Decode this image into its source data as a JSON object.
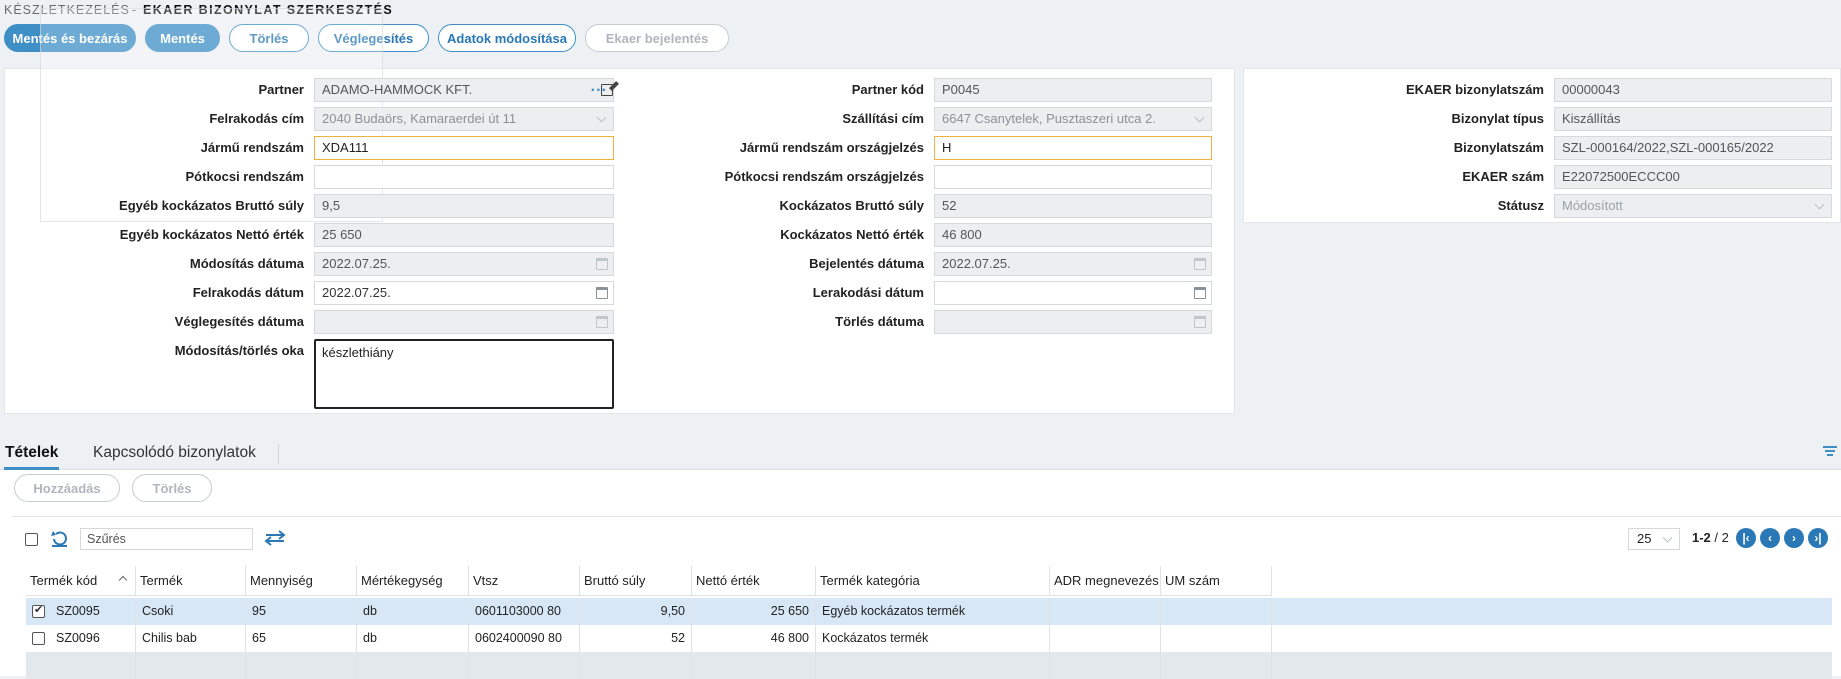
{
  "breadcrumb": {
    "parent": "KÉSZLETKEZELÉS",
    "separator": "-",
    "title": "EKAER BIZONYLAT SZERKESZTÉS"
  },
  "toolbar": {
    "save_close": "Mentés és bezárás",
    "save": "Mentés",
    "delete": "Törlés",
    "finalize": "Véglegesítés",
    "modify_data": "Adatok módosítása",
    "ekaer_report": "Ekaer bejelentés"
  },
  "form_left": {
    "partner_label": "Partner",
    "partner_value": "ADAMO-HAMMOCK KFT.",
    "partner_dots": "...",
    "loading_addr_label": "Felrakodás cím",
    "loading_addr_value": "2040 Budaörs, Kamaraerdei út 11",
    "vehicle_plate_label": "Jármű rendszám",
    "vehicle_plate_value": "XDA111",
    "trailer_plate_label": "Pótkocsi rendszám",
    "trailer_plate_value": "",
    "other_gross_label": "Egyéb kockázatos Bruttó súly",
    "other_gross_value": "9,5",
    "other_net_label": "Egyéb kockázatos Nettó érték",
    "other_net_value": "25 650",
    "mod_date_label": "Módosítás dátuma",
    "mod_date_value": "2022.07.25.",
    "loading_date_label": "Felrakodás dátum",
    "loading_date_value": "2022.07.25.",
    "final_date_label": "Véglegesítés dátuma",
    "final_date_value": "",
    "reason_label": "Módosítás/törlés oka",
    "reason_value": "készlethiány"
  },
  "form_mid": {
    "partner_code_label": "Partner kód",
    "partner_code_value": "P0045",
    "delivery_addr_label": "Szállítási cím",
    "delivery_addr_value": "6647 Csanytelek, Pusztaszeri utca 2.",
    "vehicle_country_label": "Jármű rendszám országjelzés",
    "vehicle_country_value": "H",
    "trailer_country_label": "Pótkocsi rendszám országjelzés",
    "trailer_country_value": "",
    "risk_gross_label": "Kockázatos Bruttó súly",
    "risk_gross_value": "52",
    "risk_net_label": "Kockázatos Nettó érték",
    "risk_net_value": "46 800",
    "report_date_label": "Bejelentés dátuma",
    "report_date_value": "2022.07.25.",
    "unloading_date_label": "Lerakodási dátum",
    "unloading_date_value": "",
    "delete_date_label": "Törlés dátuma",
    "delete_date_value": ""
  },
  "form_right": {
    "ekaer_doc_no_label": "EKAER bizonylatszám",
    "ekaer_doc_no_value": "00000043",
    "doc_type_label": "Bizonylat típus",
    "doc_type_value": "Kiszállítás",
    "doc_no_label": "Bizonylatszám",
    "doc_no_value": "SZL-000164/2022,SZL-000165/2022",
    "ekaer_no_label": "EKAER szám",
    "ekaer_no_value": "E22072500ECCC00",
    "status_label": "Státusz",
    "status_value": "Módosított"
  },
  "tabs": {
    "items": "Tételek",
    "related": "Kapcsolódó bizonylatok"
  },
  "items_toolbar": {
    "add": "Hozzáadás",
    "delete": "Törlés"
  },
  "grid": {
    "search_placeholder": "Szűrés",
    "page_size": "25",
    "range": "1-2",
    "total": "/ 2",
    "columns": [
      "Termék kód",
      "Termék",
      "Mennyiség",
      "Mértékegység",
      "Vtsz",
      "Bruttó súly",
      "Nettó érték",
      "Termék kategória",
      "ADR megnevezés",
      "UM szám"
    ],
    "rows": [
      {
        "checked": true,
        "code": "SZ0095",
        "name": "Csoki",
        "qty": "95",
        "unit": "db",
        "vtsz": "0601103000 80",
        "gross": "9,50",
        "net": "25 650",
        "category": "Egyéb kockázatos termék",
        "adr": "",
        "um": ""
      },
      {
        "checked": false,
        "code": "SZ0096",
        "name": "Chilis bab",
        "qty": "65",
        "unit": "db",
        "vtsz": "0602400090 80",
        "gross": "52",
        "net": "46 800",
        "category": "Kockázatos termék",
        "adr": "",
        "um": ""
      }
    ]
  },
  "colors": {
    "accent": "#3d8fc6",
    "selected_row": "#d7e7f6",
    "edit_border": "#f0b23d"
  }
}
